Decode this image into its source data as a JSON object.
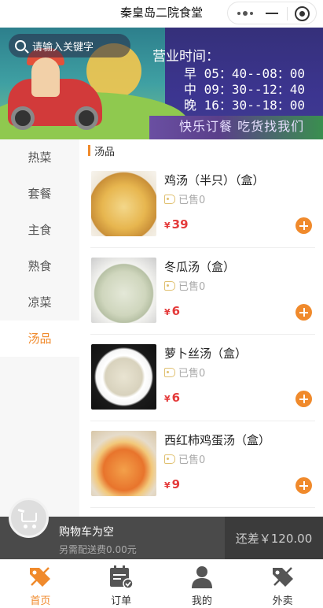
{
  "header": {
    "title": "秦皇岛二院食堂"
  },
  "search": {
    "placeholder": "请输入关键字"
  },
  "banner": {
    "hours_title": "营业时间：",
    "hours": [
      {
        "label": "早",
        "time": "05：40--08：00"
      },
      {
        "label": "中",
        "time": "09：30--12：40"
      },
      {
        "label": "晚",
        "time": "16：30--18：00"
      }
    ],
    "slogan": "快乐订餐 吃货找我们"
  },
  "categories": [
    {
      "label": "热菜"
    },
    {
      "label": "套餐"
    },
    {
      "label": "主食"
    },
    {
      "label": "熟食"
    },
    {
      "label": "凉菜"
    },
    {
      "label": "汤品",
      "active": true
    }
  ],
  "section": {
    "title": "汤品"
  },
  "items": [
    {
      "name": "鸡汤（半只）（盒）",
      "sold": "已售0",
      "currency": "¥",
      "price": "39"
    },
    {
      "name": "冬瓜汤（盒）",
      "sold": "已售0",
      "currency": "¥",
      "price": "6"
    },
    {
      "name": "萝卜丝汤（盒）",
      "sold": "已售0",
      "currency": "¥",
      "price": "6"
    },
    {
      "name": "西红柿鸡蛋汤（盒）",
      "sold": "已售0",
      "currency": "¥",
      "price": "9"
    }
  ],
  "cart": {
    "status": "购物车为空",
    "delivery_fee": "另需配送费0.00元",
    "shortfall": "还差￥120.00"
  },
  "tabs": [
    {
      "label": "首页",
      "icon": "home-tag-icon",
      "active": true
    },
    {
      "label": "订单",
      "icon": "order-calendar-icon"
    },
    {
      "label": "我的",
      "icon": "user-icon"
    },
    {
      "label": "外卖",
      "icon": "takeout-tag-icon"
    }
  ],
  "colors": {
    "accent": "#f08a2c",
    "price": "#e43a3a",
    "cartbar": "#4a4a4a"
  }
}
